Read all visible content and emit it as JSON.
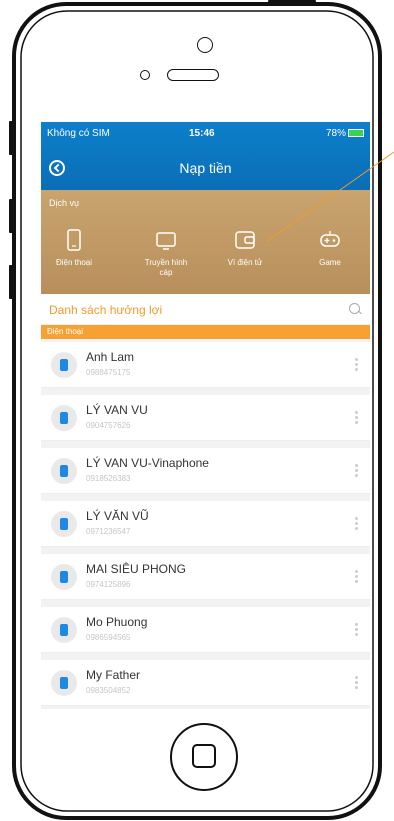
{
  "status": {
    "carrier": "Không có SIM",
    "time": "15:46",
    "battery": "78%"
  },
  "header": {
    "title": "Nạp tiền"
  },
  "service": {
    "label": "Dịch vụ",
    "items": [
      {
        "label": "Điện thoại",
        "sub": "",
        "icon": "phone-icon"
      },
      {
        "label": "Truyền hình",
        "sub": "cáp",
        "icon": "tv-icon"
      },
      {
        "label": "Ví điện tử",
        "sub": "",
        "icon": "wallet-icon"
      },
      {
        "label": "Game",
        "sub": "",
        "icon": "gamepad-icon"
      }
    ]
  },
  "list_header": {
    "title": "Danh sách hưởng lợi"
  },
  "section": {
    "label": "Điện thoại"
  },
  "contacts": [
    {
      "name": "Anh Lam",
      "number": "0988475175"
    },
    {
      "name": "LÝ VAN VU",
      "number": "0904757626"
    },
    {
      "name": "LÝ VAN VU-Vinaphone",
      "number": "0918526383"
    },
    {
      "name": "LÝ VĂN VŨ",
      "number": "0971236547"
    },
    {
      "name": "MAI SIÊU PHONG",
      "number": "0974125896"
    },
    {
      "name": "Mo Phuong",
      "number": "0986594565"
    },
    {
      "name": "My Father",
      "number": "0983504852"
    }
  ],
  "colors": {
    "header_blue": "#0b75c0",
    "service_gold": "#c19b67",
    "accent_orange": "#f8a133"
  }
}
